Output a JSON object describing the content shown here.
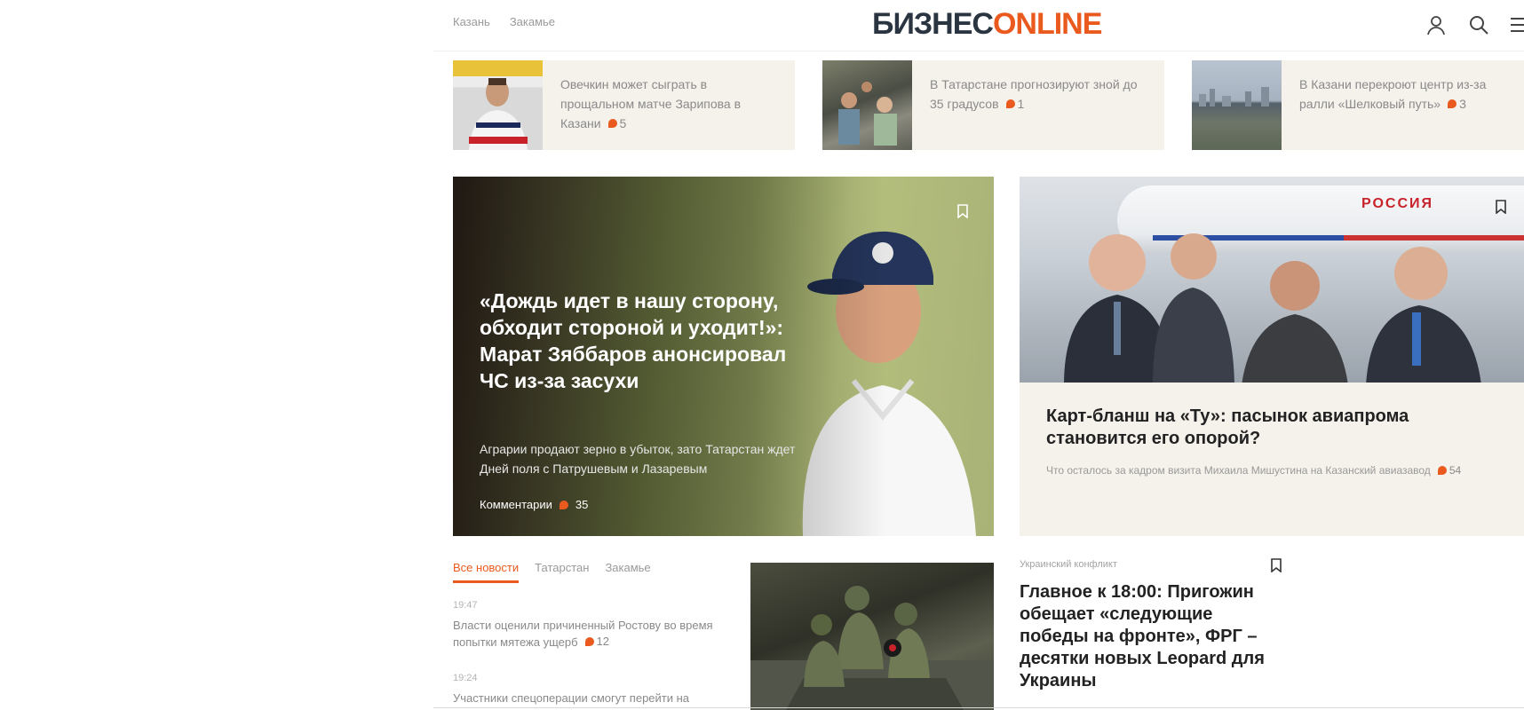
{
  "header": {
    "city_links": [
      "Казань",
      "Закамье"
    ],
    "logo_dark": "БИЗНЕС",
    "logo_accent": "ONLINE"
  },
  "top_news": [
    {
      "title": "Овечкин может сыграть в прощальном матче Зарипова в Казани",
      "comments": "5"
    },
    {
      "title": "В Татарстане прогнозируют зной до 35 градусов",
      "comments": "1"
    },
    {
      "title": "В Казани перекроют центр из-за ралли «Шелковый путь»",
      "comments": "3"
    }
  ],
  "hero": {
    "title": "«Дождь идет в нашу сторону, обходит стороной и уходит!»: Марат Зябба­ров анонсировал ЧС из-за засухи",
    "lead": "Аграрии продают зерно в убыток, зато Татарстан ждет Дней поля с Патрушевым и Лазаревым",
    "comments_label": "Комментарии",
    "comments": "35"
  },
  "right_card": {
    "plane_text": "РОССИЯ",
    "title": "Карт-бланш на «Ту»: пасынок авиапрома становится его опорой?",
    "subtitle": "Что осталось за кадром визита Михаила Мишустина на Казанский авиазавод",
    "comments": "54"
  },
  "feed": {
    "tabs": [
      "Все новости",
      "Татарстан",
      "Закамье"
    ],
    "items": [
      {
        "time": "19:47",
        "title": "Власти оценили причиненный Ростову во время попытки мятежа ущерб",
        "comments": "12"
      },
      {
        "time": "19:24",
        "title": "Участники спецоперации смогут перейти на"
      }
    ]
  },
  "main_news": {
    "rubric": "Украинский конфликт",
    "title": "Главное к 18:00: Пригожин обещает «следующие победы на фронте», ФРГ – десятки новых Leopard для Украины"
  },
  "colors": {
    "accent": "#ea5a1e",
    "logo_dark": "#2b3542",
    "card_bg": "#f5f1eb"
  },
  "icons": [
    "user-icon",
    "search-icon",
    "menu-icon",
    "bookmark-icon",
    "comment-icon"
  ]
}
